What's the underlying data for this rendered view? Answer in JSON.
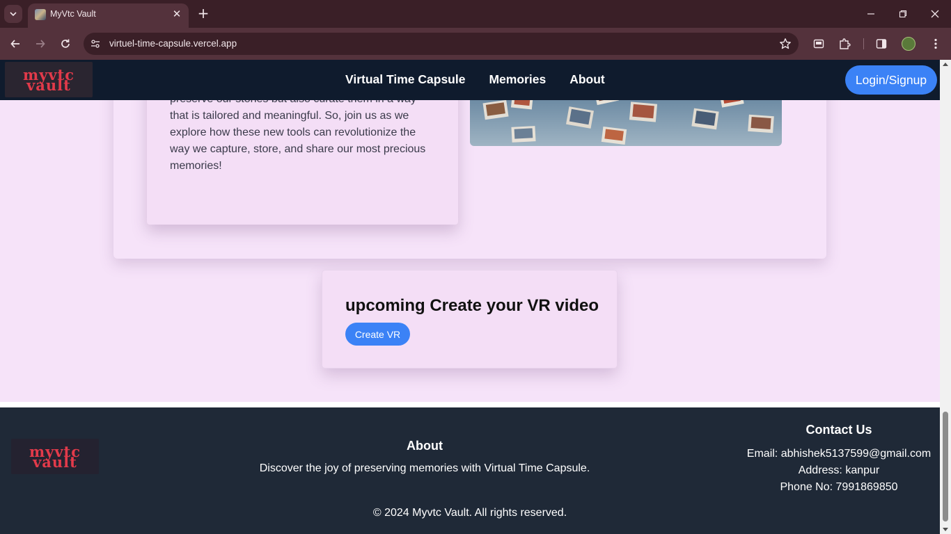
{
  "browser": {
    "tab_title": "MyVtc Vault",
    "new_tab_label": "+",
    "url": "virtuel-time-capsule.vercel.app"
  },
  "site": {
    "logo_line1": "myvtc",
    "logo_line2": "vault",
    "nav": [
      "Virtual Time Capsule",
      "Memories",
      "About"
    ],
    "login_label": "Login/Signup"
  },
  "intro": {
    "paragraph": "platforms, we now have the ability to not only preserve our stories but also curate them in a way that is tailored and meaningful. So, join us as we explore how these new tools can revolutionize the way we capture, store, and share our most precious memories!"
  },
  "vr": {
    "title": "upcoming Create your VR video",
    "button_label": "Create VR"
  },
  "footer": {
    "logo_line1": "myvtc",
    "logo_line2": "vault",
    "about_title": "About",
    "about_text": "Discover the joy of preserving memories with Virtual Time Capsule.",
    "contact_title": "Contact Us",
    "email": "Email: abhishek5137599@gmail.com",
    "address": "Address: kanpur",
    "phone": "Phone No: 7991869850",
    "copyright": "© 2024 Myvtc Vault. All rights reserved."
  },
  "colors": {
    "header_bg": "#0f1b2d",
    "page_bg": "#f6e3f9",
    "footer_bg": "#1f2937",
    "accent": "#3b82f6",
    "logo_red": "#e23a4a"
  }
}
